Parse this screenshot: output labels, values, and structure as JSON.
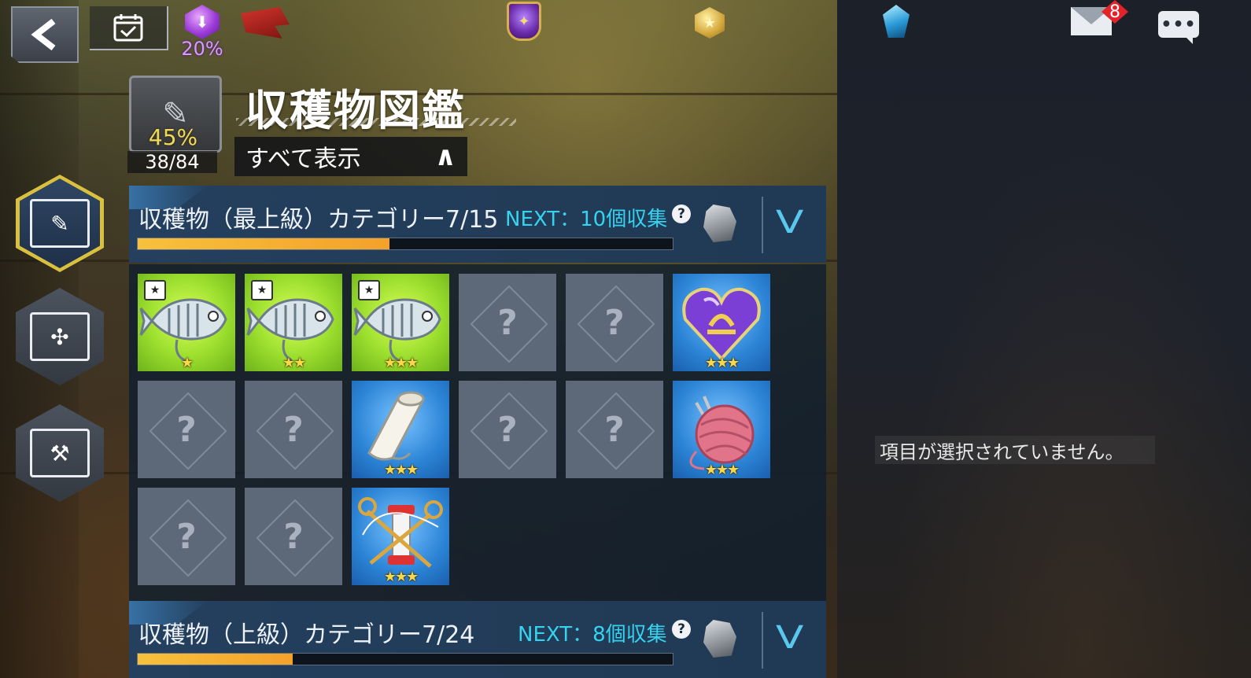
{
  "topbar": {
    "boost_percent": "20%",
    "mail_badge": "8",
    "chat_glyph": "•••",
    "icons": [
      "back-arrow-icon",
      "calendar-check-icon",
      "purple-gem-icon",
      "red-flag-icon",
      "guild-crest-icon",
      "gold-medal-icon",
      "blue-crystal-icon",
      "mail-icon",
      "chat-icon"
    ]
  },
  "header": {
    "title": "収穫物図鑑",
    "progress_percent": "45%",
    "progress_count": "38/84",
    "filter_label": "すべて表示",
    "filter_chevron": "∧"
  },
  "side_tabs": [
    {
      "name": "harvest",
      "icon": "book-pen-icon",
      "active": true
    },
    {
      "name": "recipe",
      "icon": "book-sparkle-icon",
      "active": false
    },
    {
      "name": "cooking",
      "icon": "book-hammer-icon",
      "active": false
    }
  ],
  "categories": [
    {
      "title": "収穫物（最上級）カテゴリー7/15",
      "next": "NEXT：10個収集",
      "help": "?",
      "toggle": "V",
      "progress": 0.47,
      "expanded": true
    },
    {
      "title": "収穫物（上級）カテゴリー7/24",
      "next": "NEXT：8個収集",
      "help": "?",
      "toggle": "V",
      "progress": 0.29,
      "expanded": false
    }
  ],
  "tiles": [
    {
      "state": "owned",
      "item": "bone-fish-icon",
      "stars": "★",
      "event": true
    },
    {
      "state": "owned",
      "item": "bone-fish-icon",
      "stars": "★★",
      "event": true
    },
    {
      "state": "owned",
      "item": "bone-fish-icon",
      "stars": "★★★",
      "event": true
    },
    {
      "state": "locked",
      "mark": "?"
    },
    {
      "state": "locked",
      "mark": "?"
    },
    {
      "state": "owned",
      "item": "libra-heart-gem-icon",
      "stars": "★★★"
    },
    {
      "state": "locked",
      "mark": "?"
    },
    {
      "state": "locked",
      "mark": "?"
    },
    {
      "state": "owned",
      "item": "paper-roll-icon",
      "stars": "★★★"
    },
    {
      "state": "locked",
      "mark": "?"
    },
    {
      "state": "locked",
      "mark": "?"
    },
    {
      "state": "owned",
      "item": "yarn-ball-icon",
      "stars": "★★★"
    },
    {
      "state": "locked",
      "mark": "?"
    },
    {
      "state": "locked",
      "mark": "?"
    },
    {
      "state": "owned",
      "item": "thread-spool-scissors-icon",
      "stars": "★★★"
    }
  ],
  "detail_panel": {
    "empty_message": "項目が選択されていません。"
  },
  "colors": {
    "accent_gold": "#f6c13c",
    "next_cyan": "#35d3f0",
    "panel_blue": "#24405e",
    "tile_green": "#9bde2e",
    "tile_blue": "#2c84d6",
    "badge_red": "#e2232a"
  }
}
